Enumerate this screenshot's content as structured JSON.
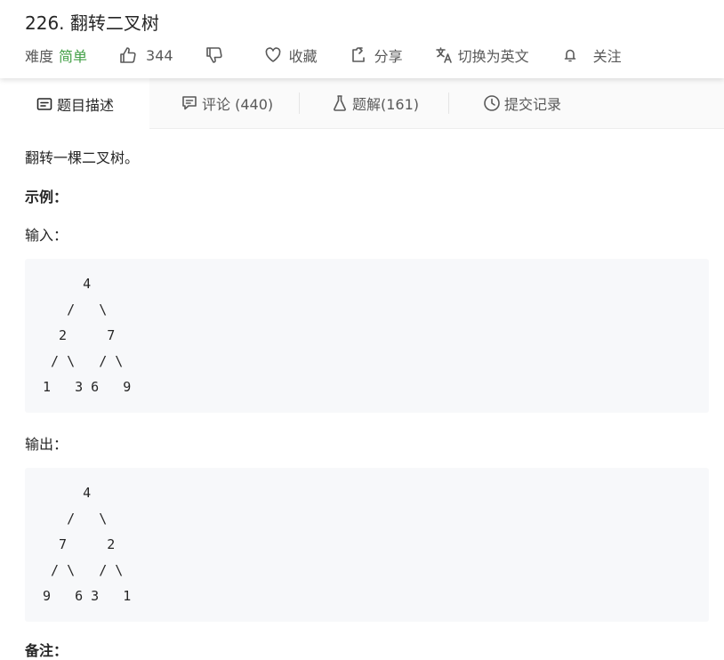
{
  "problem": {
    "title": "226. 翻转二叉树",
    "difficulty_label": "难度",
    "difficulty_value": "简单",
    "likes": "344",
    "favorite_label": "收藏",
    "share_label": "分享",
    "lang_label": "切换为英文",
    "follow_label": "关注"
  },
  "tabs": [
    {
      "label": "题目描述",
      "icon": "description-icon",
      "active": true
    },
    {
      "label": "评论 (440)",
      "icon": "comment-icon"
    },
    {
      "label": "题解(161)",
      "icon": "flask-icon"
    },
    {
      "label": "提交记录",
      "icon": "clock-icon"
    }
  ],
  "content": {
    "intro": "翻转一棵二叉树。",
    "example_heading": "示例：",
    "input_label": "输入：",
    "input_tree": "     4\n   /   \\\n  2     7\n / \\   / \\\n1   3 6   9",
    "output_label": "输出：",
    "output_tree": "     4\n   /   \\\n  7     2\n / \\   / \\\n9   6 3   1",
    "note_heading": "备注："
  },
  "colors": {
    "accent_green": "#43a047",
    "code_bg": "#f7f8fa"
  }
}
